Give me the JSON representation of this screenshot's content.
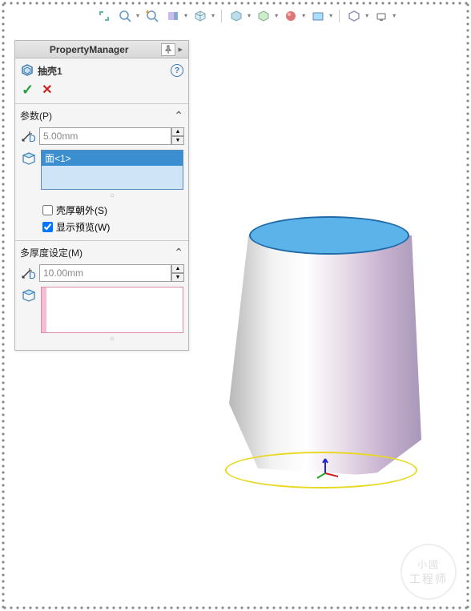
{
  "panel_title": "PropertyManager",
  "feature_name": "抽壳1",
  "section_params": {
    "title": "参数(P)"
  },
  "dim1": {
    "value": "5.00mm"
  },
  "faces": {
    "item0": "面<1>"
  },
  "check_shell_outward": {
    "label": "壳厚朝外(S)",
    "checked": false
  },
  "check_show_preview": {
    "label": "显示预览(W)",
    "checked": true
  },
  "section_multi": {
    "title": "多厚度设定(M)"
  },
  "dim2": {
    "value": "10.00mm"
  },
  "watermark": {
    "line1": "小國",
    "line2": "工程师"
  }
}
